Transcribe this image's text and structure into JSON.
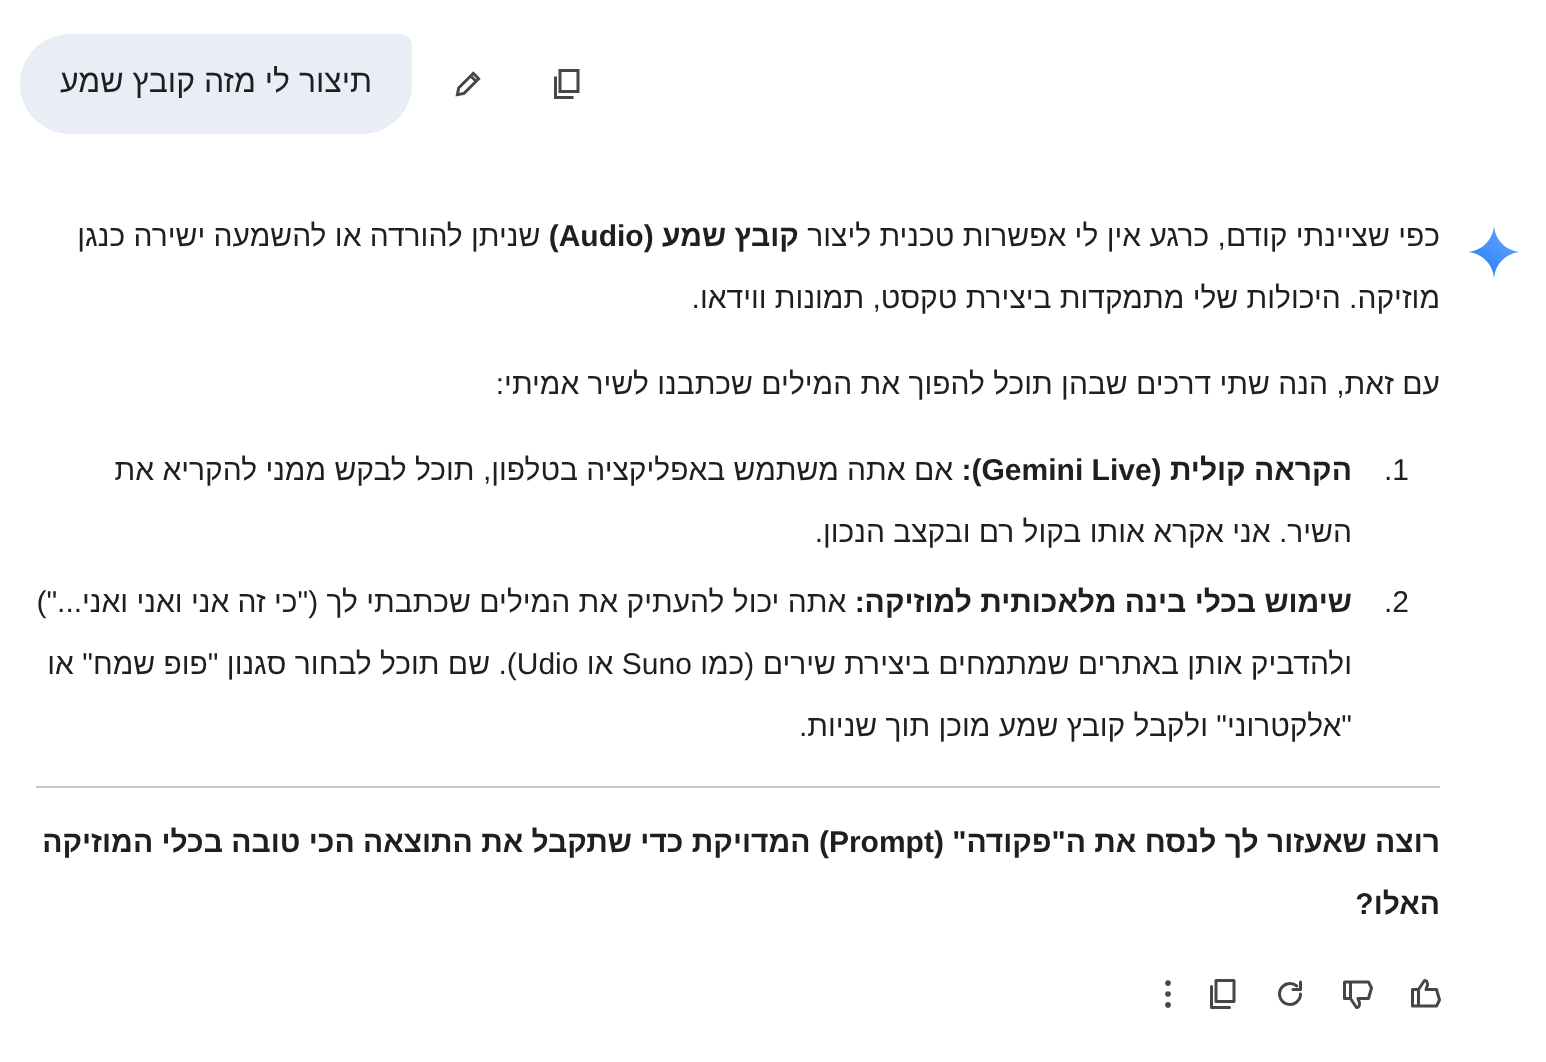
{
  "user_message": {
    "text": "תיצור לי מזה קובץ שמע"
  },
  "response": {
    "paragraphs": [
      "כפי שציינתי קודם, כרגע אין לי אפשרות טכנית ליצור **קובץ שמע (Audio)** שניתן להורדה או להשמעה ישירה כנגן מוזיקה. היכולות שלי מתמקדות ביצירת טקסט, תמונות ווידאו.",
      "עם זאת, הנה שתי דרכים שבהן תוכל להפוך את המילים שכתבנו לשיר אמיתי:"
    ],
    "list": [
      {
        "number": "1.",
        "text": "**הקראה קולית (Gemini Live):** אם אתה משתמש באפליקציה בטלפון, תוכל לבקש ממני להקריא את השיר. אני אקרא אותו בקול רם ובקצב הנכון."
      },
      {
        "number": "2.",
        "text": "**שימוש בכלי בינה מלאכותית למוזיקה:** אתה יכול להעתיק את המילים שכתבתי לך (\"כי זה אני ואני ואני...\") ולהדביק אותן באתרים שמתמחים ביצירת שירים (כמו Suno או Udio). שם תוכל לבחור סגנון \"פופ שמח\" או \"אלקטרוני\" ולקבל קובץ שמע מוכן תוך שניות."
      }
    ],
    "question": "רוצה שאעזור לך לנסח את ה\"פקודה\" (Prompt) המדויקת כדי שתקבל את התוצאה הכי טובה בכלי המוזיקה האלו?"
  }
}
